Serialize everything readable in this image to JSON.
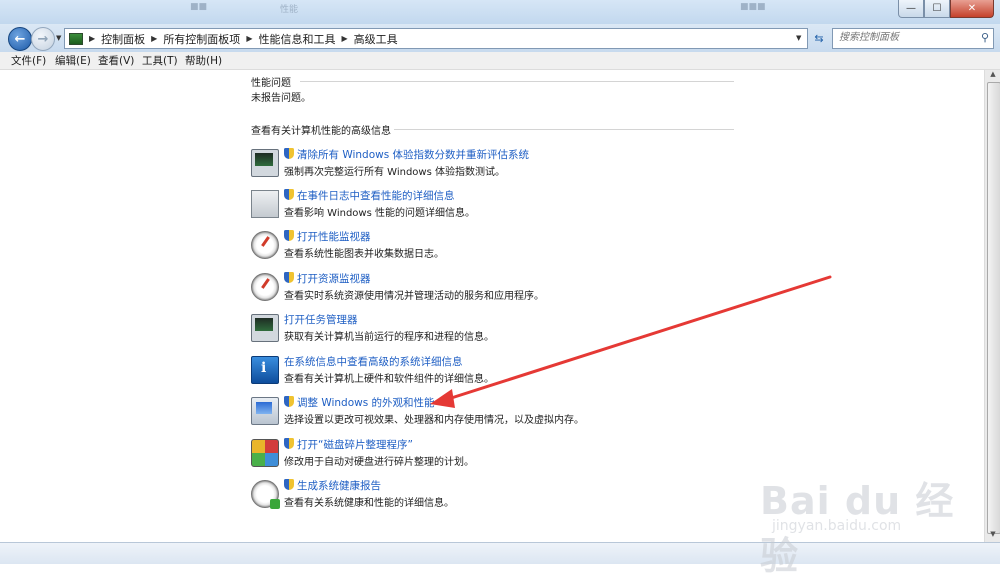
{
  "titlebar": {
    "ghost_left": "■■",
    "ghost_mid": "性能",
    "ghost_right": "■■■"
  },
  "window_controls": {
    "minimize": "—",
    "maximize": "☐",
    "close": "✕"
  },
  "navigation": {
    "back": "←",
    "forward": "→",
    "breadcrumbs": [
      "控制面板",
      "所有控制面板项",
      "性能信息和工具",
      "高级工具"
    ],
    "search_placeholder": "搜索控制面板"
  },
  "menu": [
    "文件(F)",
    "编辑(E)",
    "查看(V)",
    "工具(T)",
    "帮助(H)"
  ],
  "sections": {
    "issues_title": "性能问题",
    "issues_text": "未报告问题。",
    "advanced_title": "查看有关计算机性能的高级信息"
  },
  "tasks": [
    {
      "link": "清除所有 Windows 体验指数分数并重新评估系统",
      "desc": "强制再次完整运行所有 Windows 体验指数测试。",
      "shield": true,
      "icon": "monitor-icon"
    },
    {
      "link": "在事件日志中查看性能的详细信息",
      "desc": "查看影响 Windows 性能的问题详细信息。",
      "shield": true,
      "icon": "event-log-icon"
    },
    {
      "link": "打开性能监视器",
      "desc": "查看系统性能图表并收集数据日志。",
      "shield": true,
      "icon": "performance-gauge-icon"
    },
    {
      "link": "打开资源监视器",
      "desc": "查看实时系统资源使用情况并管理活动的服务和应用程序。",
      "shield": true,
      "icon": "resource-gauge-icon"
    },
    {
      "link": "打开任务管理器",
      "desc": "获取有关计算机当前运行的程序和进程的信息。",
      "shield": false,
      "icon": "task-manager-icon"
    },
    {
      "link": "在系统信息中查看高级的系统详细信息",
      "desc": "查看有关计算机上硬件和软件组件的详细信息。",
      "shield": false,
      "icon": "system-info-icon"
    },
    {
      "link": "调整 Windows 的外观和性能",
      "desc": "选择设置以更改可视效果、处理器和内存使用情况，以及虚拟内存。",
      "shield": true,
      "icon": "visual-effects-icon"
    },
    {
      "link": "打开“磁盘碎片整理程序”",
      "desc": "修改用于自动对硬盘进行碎片整理的计划。",
      "shield": true,
      "icon": "defrag-icon"
    },
    {
      "link": "生成系统健康报告",
      "desc": "查看有关系统健康和性能的详细信息。",
      "shield": true,
      "icon": "health-report-icon"
    }
  ],
  "annotation": {
    "color": "#e53935"
  },
  "watermark": {
    "logo": "Bai du 经验",
    "url": "jingyan.baidu.com"
  }
}
